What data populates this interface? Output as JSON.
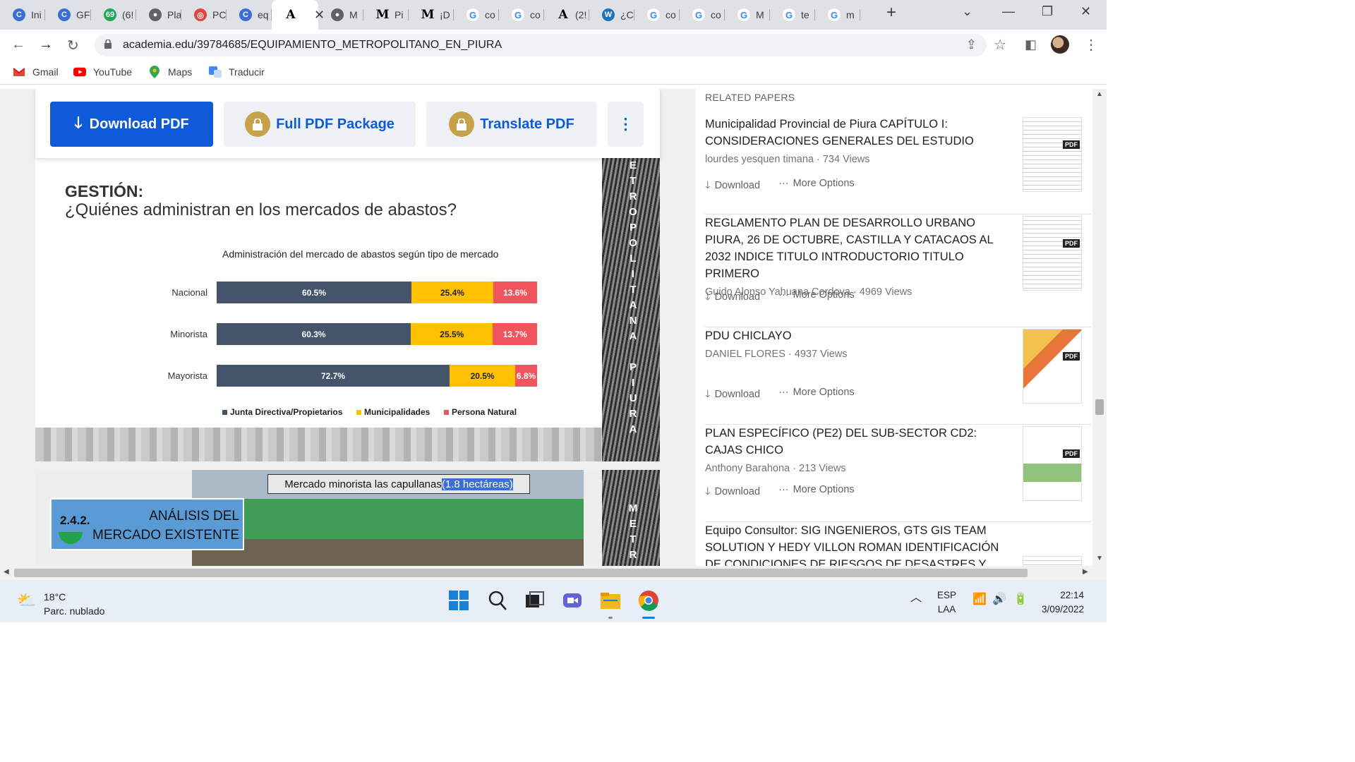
{
  "tabs": [
    {
      "label": "Ini",
      "icon": "copilot-icon",
      "color": "#3b6fd6",
      "glyph": "C"
    },
    {
      "label": "GF",
      "icon": "copilot-icon",
      "color": "#3b6fd6",
      "glyph": "C"
    },
    {
      "label": "(6!",
      "icon": "whatsapp-icon",
      "color": "#1fa855",
      "glyph": "69"
    },
    {
      "label": "Pla",
      "icon": "globe-icon",
      "color": "#5f6368",
      "glyph": "●"
    },
    {
      "label": "PC",
      "icon": "target-icon",
      "color": "#e0473a",
      "glyph": "◎"
    },
    {
      "label": "eq",
      "icon": "copilot-icon",
      "color": "#3b6fd6",
      "glyph": "C"
    },
    {
      "label": "",
      "icon": "academia-icon",
      "color": "#000000",
      "glyph": "A",
      "active": true
    },
    {
      "label": "M",
      "icon": "globe-icon",
      "color": "#5f6368",
      "glyph": "●"
    },
    {
      "label": "Pi",
      "icon": "medium-icon",
      "color": "#000000",
      "glyph": "M"
    },
    {
      "label": "¡D",
      "icon": "medium-icon",
      "color": "#000000",
      "glyph": "M"
    },
    {
      "label": "co",
      "icon": "google-icon",
      "color": "#4285f4",
      "glyph": "G"
    },
    {
      "label": "co",
      "icon": "google-icon",
      "color": "#4285f4",
      "glyph": "G"
    },
    {
      "label": "(2!",
      "icon": "academia-icon",
      "color": "#000000",
      "glyph": "A"
    },
    {
      "label": "¿C",
      "icon": "wordpress-icon",
      "color": "#2273b8",
      "glyph": "W"
    },
    {
      "label": "co",
      "icon": "google-icon",
      "color": "#4285f4",
      "glyph": "G"
    },
    {
      "label": "co",
      "icon": "google-icon",
      "color": "#4285f4",
      "glyph": "G"
    },
    {
      "label": "M",
      "icon": "google-icon",
      "color": "#4285f4",
      "glyph": "G"
    },
    {
      "label": "te",
      "icon": "google-icon",
      "color": "#4285f4",
      "glyph": "G"
    },
    {
      "label": "m",
      "icon": "google-icon",
      "color": "#4285f4",
      "glyph": "G"
    }
  ],
  "toolbar": {
    "url": "academia.edu/39784685/EQUIPAMIENTO_METROPOLITANO_EN_PIURA"
  },
  "bookmarks": [
    {
      "label": "Gmail",
      "icon": "gmail-icon"
    },
    {
      "label": "YouTube",
      "icon": "youtube-icon"
    },
    {
      "label": "Maps",
      "icon": "maps-icon"
    },
    {
      "label": "Traducir",
      "icon": "translate-icon"
    }
  ],
  "actions": {
    "download": "Download PDF",
    "package": "Full PDF Package",
    "translate": "Translate PDF",
    "more": "⋮"
  },
  "slide1": {
    "heading": "GESTIÓN:",
    "subheading": "¿Quiénes administran en los mercados de abastos?",
    "side_text": "ETROPOLITANA PIURA"
  },
  "chart_data": {
    "type": "bar",
    "orientation": "horizontal",
    "stacked": true,
    "title": "Administración del mercado de abastos según tipo de mercado",
    "categories": [
      "Nacional",
      "Minorista",
      "Mayorista"
    ],
    "series": [
      {
        "name": "Junta Directiva/Propietarios",
        "color": "#44546a",
        "values": [
          60.5,
          60.3,
          72.7
        ],
        "labels": [
          "60.5%",
          "60.3%",
          "72.7%"
        ]
      },
      {
        "name": "Municipalidades",
        "color": "#ffc000",
        "values": [
          25.4,
          25.5,
          20.5
        ],
        "labels": [
          "25.4%",
          "25.5%",
          "20.5%"
        ]
      },
      {
        "name": "Persona Natural",
        "color": "#f0545d",
        "values": [
          13.6,
          13.7,
          6.8
        ],
        "labels": [
          "13.6%",
          "13.7%",
          "6.8%"
        ]
      }
    ],
    "legend": "bottom"
  },
  "slide2": {
    "caption_main": "Mercado minorista las capullanas",
    "caption_highlight": "(1.8 hectáreas)",
    "section_number": "2.4.2.",
    "section_title": "ANÁLISIS DEL MERCADO EXISTENTE",
    "side_text": "METRO"
  },
  "related": {
    "heading": "RELATED PAPERS",
    "download_label": "Download",
    "more_label": "More Options",
    "papers": [
      {
        "title": "Municipalidad Provincial de Piura CAPÍTULO I: CONSIDERACIONES GENERALES DEL ESTUDIO",
        "author": "lourdes yesquen timana",
        "views": "734 Views"
      },
      {
        "title": "REGLAMENTO PLAN DE DESARROLLO URBANO PIURA, 26 DE OCTUBRE, CASTILLA Y CATACAOS AL 2032 INDICE TITULO INTRODUCTORIO TITULO PRIMERO",
        "author": "Guido Alonso Yahuana Cordova",
        "views": "4969 Views"
      },
      {
        "title": "PDU CHICLAYO",
        "author": "DANIEL FLORES",
        "views": "4937 Views"
      },
      {
        "title": "PLAN ESPECÍFICO (PE2) DEL SUB-SECTOR CD2: CAJAS CHICO",
        "author": "Anthony Barahona",
        "views": "213 Views"
      },
      {
        "title": "Equipo Consultor: SIG INGENIEROS, GTS GIS TEAM SOLUTION Y HEDY VILLON ROMAN IDENTIFICACIÓN DE CONDICIONES DE RIESGOS DE DESASTRES Y",
        "author": "",
        "views": ""
      }
    ],
    "pdf_badge": "PDF"
  },
  "taskbar": {
    "temp": "18°C",
    "weather": "Parc. nublado",
    "lang1": "ESP",
    "lang2": "LAA",
    "time": "22:14",
    "date": "3/09/2022"
  }
}
